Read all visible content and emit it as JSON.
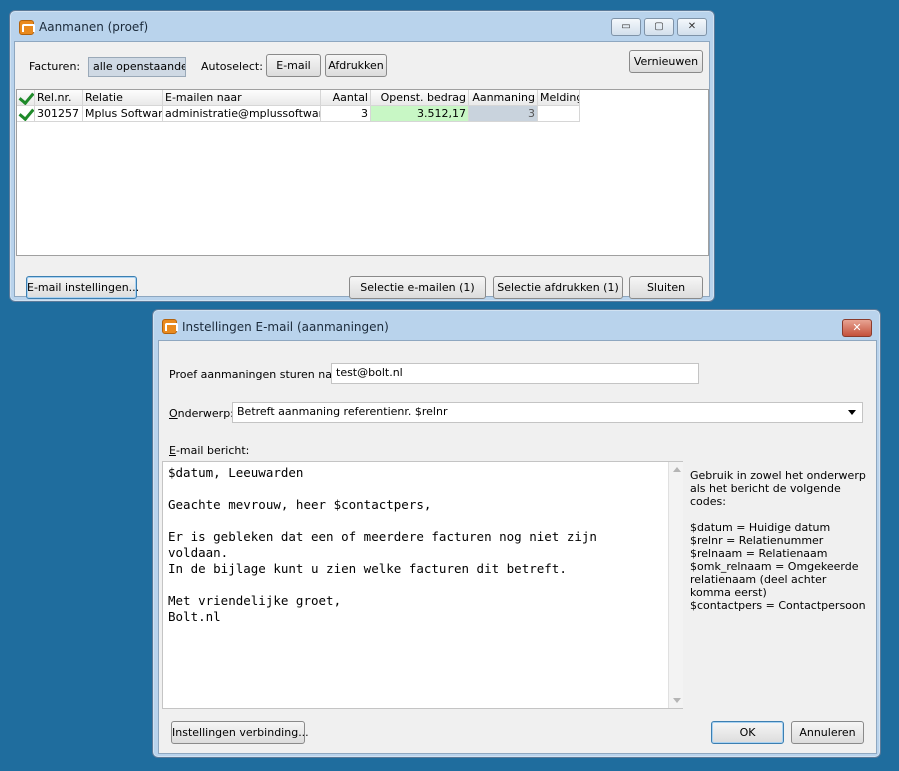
{
  "main_window": {
    "title": "Aanmanen (proef)",
    "caption_buttons": {
      "minimize": "▭",
      "maximize": "▢",
      "close": "✕"
    },
    "toolbar": {
      "facturen_label": "Facturen:",
      "facturen_value": "alle openstaande",
      "autoselect_label": "Autoselect:",
      "email_button": "E-mail",
      "print_button": "Afdrukken",
      "refresh_button": "Vernieuwen"
    },
    "grid": {
      "columns": [
        "Rel.nr.",
        "Relatie",
        "E-mailen naar",
        "Aantal",
        "Openst. bedrag",
        "Aanmaning",
        "Melding"
      ],
      "rows": [
        [
          "301257",
          "Mplus Software",
          "administratie@mplussoftware.nl",
          "3",
          "3.512,17",
          "3",
          ""
        ]
      ]
    },
    "footer": {
      "email_settings_button": "E-mail instellingen...",
      "selection_email_button": "Selectie e-mailen (1)",
      "selection_print_button": "Selectie afdrukken (1)",
      "close_button": "Sluiten"
    }
  },
  "settings_dialog": {
    "title": "Instellingen E-mail (aanmaningen)",
    "close_glyph": "✕",
    "proof_label": "Proef aanmaningen sturen naar:",
    "proof_value": "test@bolt.nl",
    "subject_label_first": "O",
    "subject_label_rest": "nderwerp:",
    "subject_value": "Betreft aanmaning referentienr. $relnr",
    "message_label_first": "E",
    "message_label_rest": "-mail bericht:",
    "message_body": "$datum, Leeuwarden\n\nGeachte mevrouw, heer $contactpers,\n\nEr is gebleken dat een of meerdere facturen nog niet zijn\nvoldaan.\nIn de bijlage kunt u zien welke facturen dit betreft.\n\nMet vriendelijke groet,\nBolt.nl",
    "help_text": "Gebruik in zowel het onderwerp als het bericht de volgende codes:\n\n$datum = Huidige datum\n$relnr = Relatienummer\n$relnaam = Relatienaam\n$omk_relnaam = Omgekeerde relatienaam (deel achter komma eerst)\n$contactpers = Contactpersoon",
    "connection_settings_button": "Instellingen verbinding...",
    "ok_button": "OK",
    "cancel_button": "Annuleren"
  },
  "colors": {
    "desktop": "#1f6d9e",
    "amount_cell": "#c8f7c5",
    "reminder_cell": "#c9d3dd",
    "check": "#1f8a2a"
  }
}
